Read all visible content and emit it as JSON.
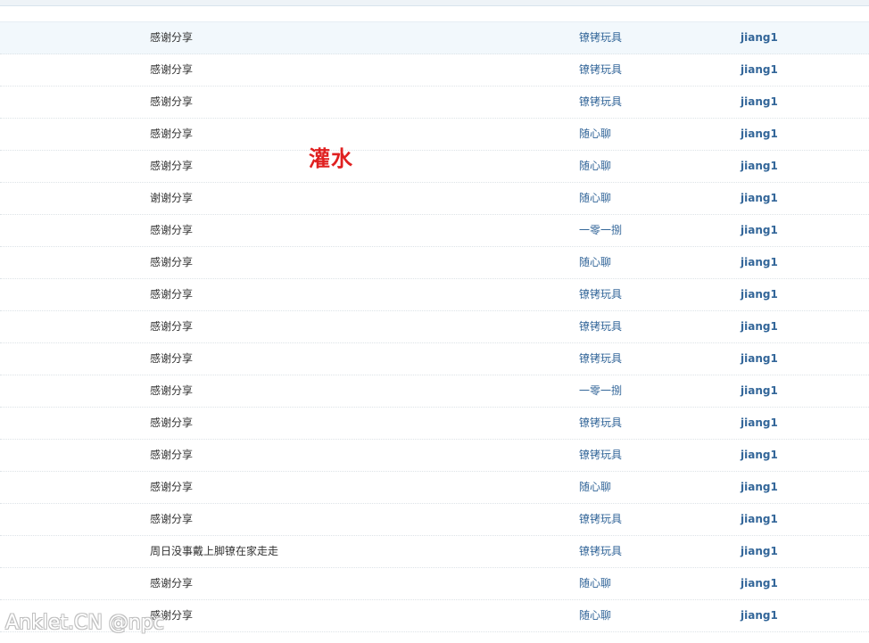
{
  "overlay_label": "灌水",
  "watermark": "Anklet.CN @npc",
  "colors": {
    "link_blue": "#336699",
    "title_text": "#333333",
    "highlight_red": "#e02020",
    "row_highlight": "#f2f8fc"
  },
  "rows": [
    {
      "title": "感谢分享",
      "forum": "镣铐玩具",
      "author": "jiang1"
    },
    {
      "title": "感谢分享",
      "forum": "镣铐玩具",
      "author": "jiang1"
    },
    {
      "title": "感谢分享",
      "forum": "镣铐玩具",
      "author": "jiang1"
    },
    {
      "title": "感谢分享",
      "forum": "随心聊",
      "author": "jiang1"
    },
    {
      "title": "感谢分享",
      "forum": "随心聊",
      "author": "jiang1"
    },
    {
      "title": "谢谢分享",
      "forum": "随心聊",
      "author": "jiang1"
    },
    {
      "title": "感谢分享",
      "forum": "一零一捌",
      "author": "jiang1"
    },
    {
      "title": "感谢分享",
      "forum": "随心聊",
      "author": "jiang1"
    },
    {
      "title": "感谢分享",
      "forum": "镣铐玩具",
      "author": "jiang1"
    },
    {
      "title": "感谢分享",
      "forum": "镣铐玩具",
      "author": "jiang1"
    },
    {
      "title": "感谢分享",
      "forum": "镣铐玩具",
      "author": "jiang1"
    },
    {
      "title": "感谢分享",
      "forum": "一零一捌",
      "author": "jiang1"
    },
    {
      "title": "感谢分享",
      "forum": "镣铐玩具",
      "author": "jiang1"
    },
    {
      "title": "感谢分享",
      "forum": "镣铐玩具",
      "author": "jiang1"
    },
    {
      "title": "感谢分享",
      "forum": "随心聊",
      "author": "jiang1"
    },
    {
      "title": "感谢分享",
      "forum": "镣铐玩具",
      "author": "jiang1"
    },
    {
      "title": "周日没事戴上脚镣在家走走",
      "forum": "镣铐玩具",
      "author": "jiang1"
    },
    {
      "title": "感谢分享",
      "forum": "随心聊",
      "author": "jiang1"
    },
    {
      "title": "感谢分享",
      "forum": "随心聊",
      "author": "jiang1"
    }
  ]
}
